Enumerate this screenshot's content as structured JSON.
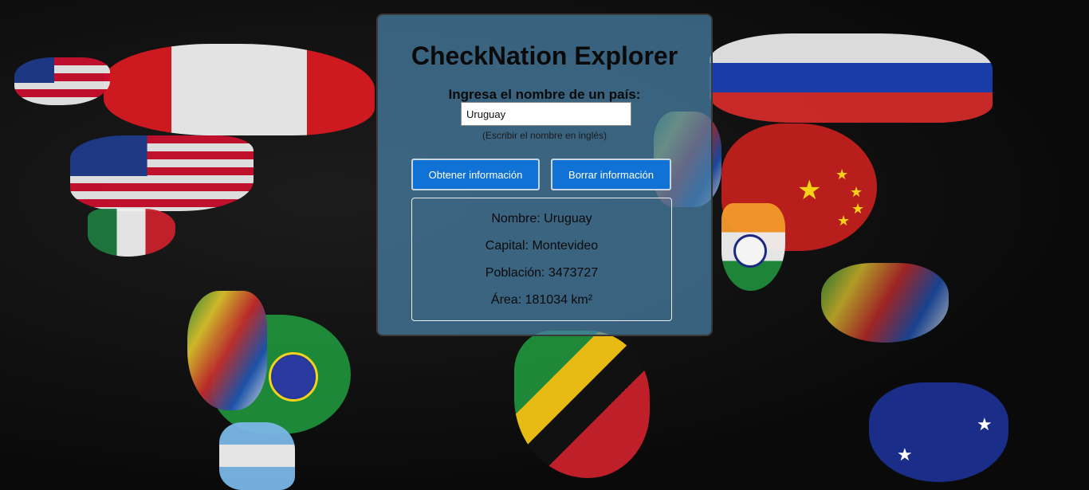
{
  "app": {
    "title": "CheckNation Explorer"
  },
  "form": {
    "label": "Ingresa el nombre de un país:",
    "input_value": "Uruguay",
    "hint": "(Escribir el nombre en inglés)"
  },
  "buttons": {
    "get_label": "Obtener información",
    "clear_label": "Borrar información"
  },
  "result": {
    "name": "Nombre: Uruguay",
    "capital": "Capital: Montevideo",
    "population": "Población: 3473727",
    "area": "Área: 181034 km²"
  },
  "colors": {
    "panel_bg": "#4a82aa",
    "button_bg": "#1172d6",
    "page_bg": "#0d0d0d"
  },
  "background": {
    "description_icon": "world-flag-map-background"
  }
}
